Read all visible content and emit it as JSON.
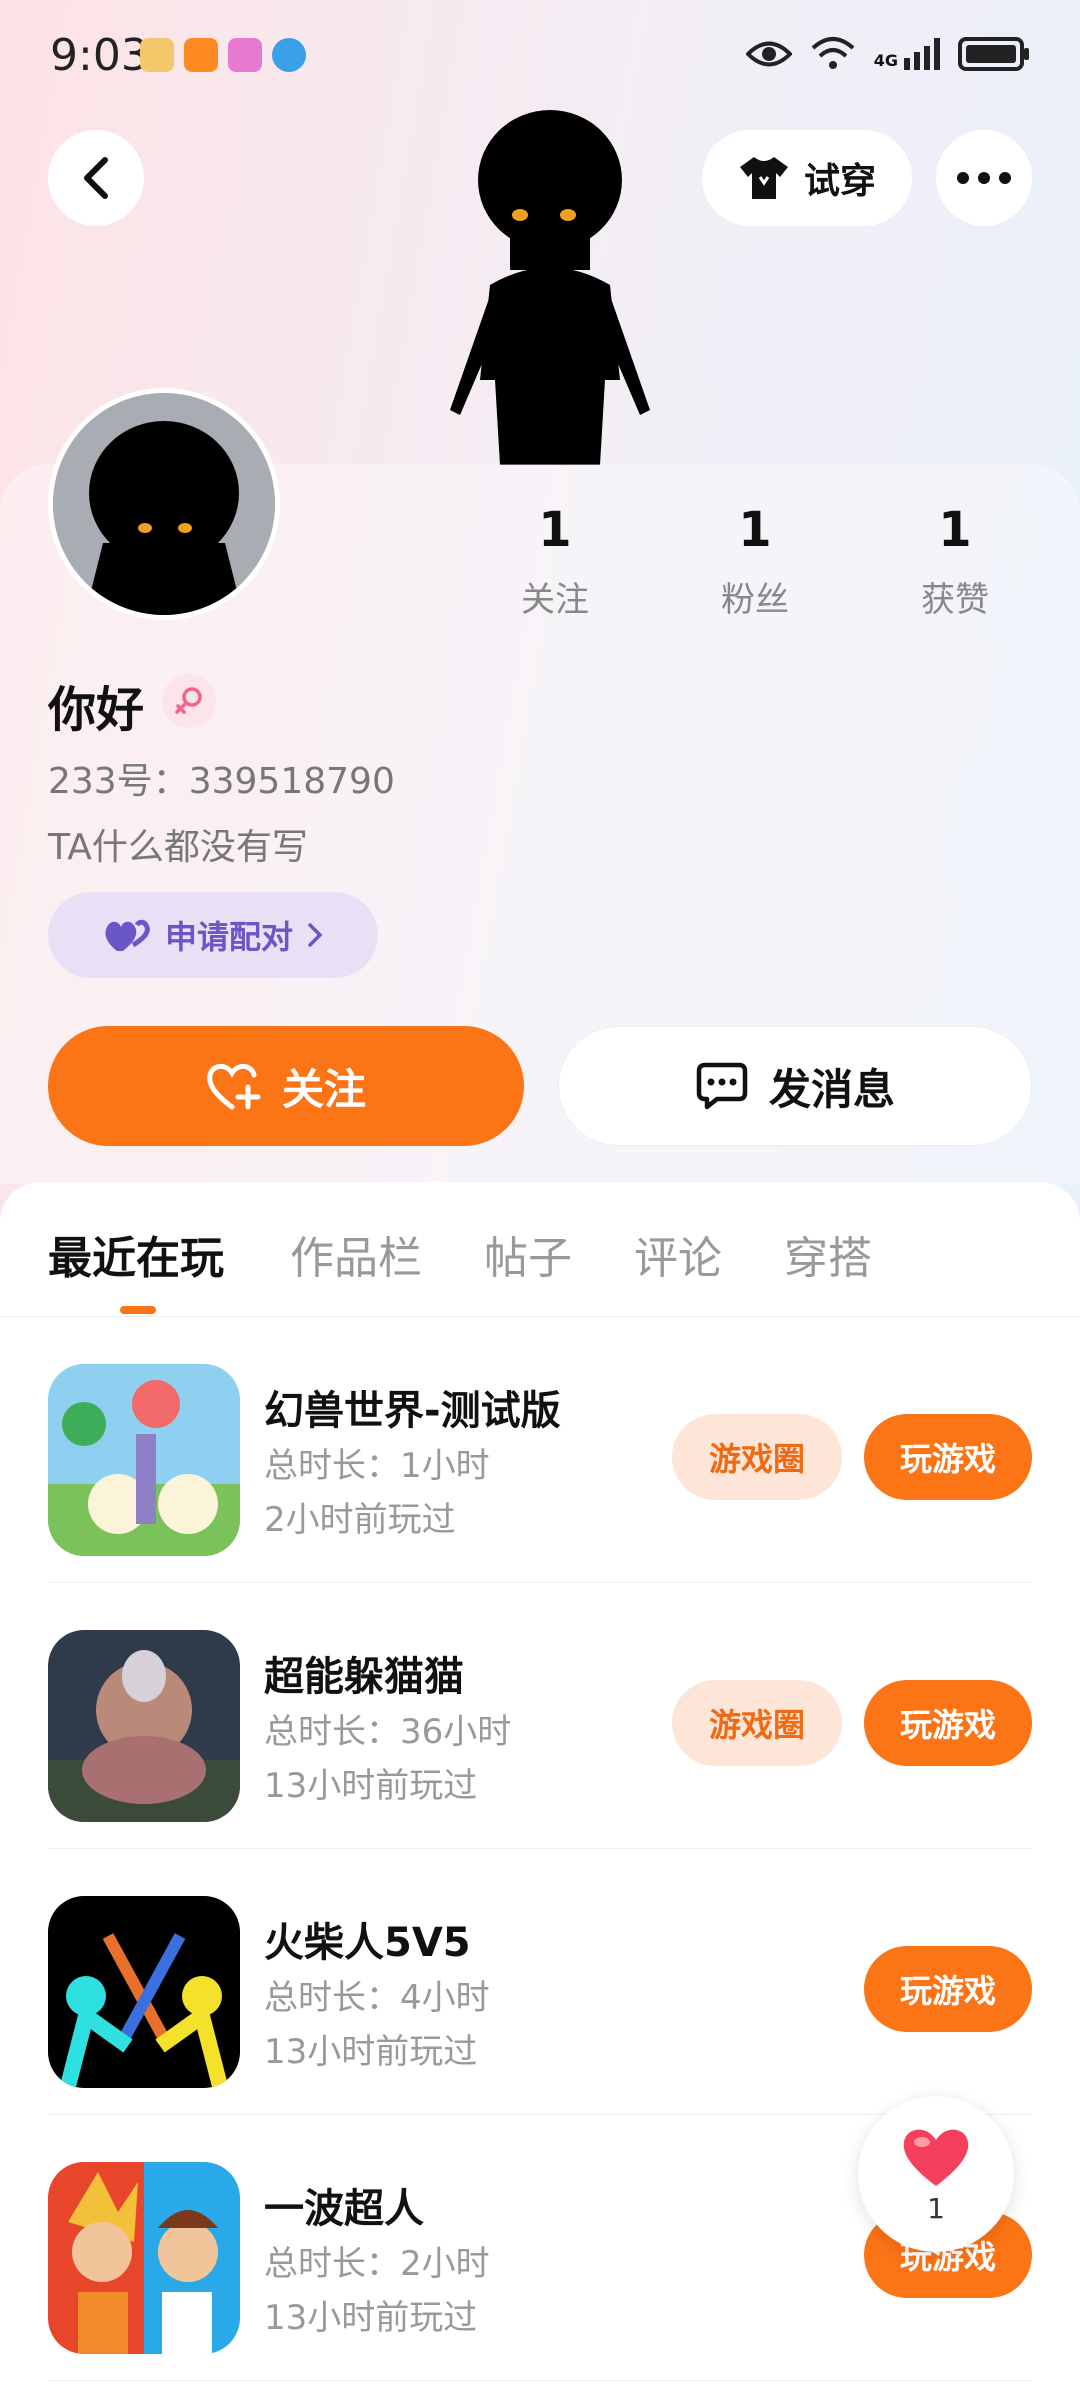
{
  "status_bar": {
    "time": "9:03",
    "network": "4G"
  },
  "header": {
    "tryon_label": "试穿"
  },
  "profile": {
    "stats": [
      {
        "value": "1",
        "label": "关注"
      },
      {
        "value": "1",
        "label": "粉丝"
      },
      {
        "value": "1",
        "label": "获赞"
      }
    ],
    "username": "你好",
    "user_id": "233号：339518790",
    "bio": "TA什么都没有写",
    "pair_label": "申请配对"
  },
  "actions": {
    "follow_label": "关注",
    "message_label": "发消息"
  },
  "tabs": [
    {
      "label": "最近在玩",
      "active": true
    },
    {
      "label": "作品栏",
      "active": false
    },
    {
      "label": "帖子",
      "active": false
    },
    {
      "label": "评论",
      "active": false
    },
    {
      "label": "穿搭",
      "active": false
    }
  ],
  "games": [
    {
      "title": "幻兽世界-测试版",
      "duration": "总时长：1小时",
      "last_played": "2小时前玩过",
      "circle_label": "游戏圈",
      "play_label": "玩游戏"
    },
    {
      "title": "超能躲猫猫",
      "duration": "总时长：36小时",
      "last_played": "13小时前玩过",
      "circle_label": "游戏圈",
      "play_label": "玩游戏"
    },
    {
      "title": "火柴人5V5",
      "duration": "总时长：4小时",
      "last_played": "13小时前玩过",
      "play_label": "玩游戏"
    },
    {
      "title": "一波超人",
      "duration": "总时长：2小时",
      "last_played": "13小时前玩过",
      "play_label": "玩游戏"
    }
  ],
  "like_float": {
    "count": "1"
  },
  "colors": {
    "accent": "#fb7415",
    "pair": "#6b56c6"
  }
}
